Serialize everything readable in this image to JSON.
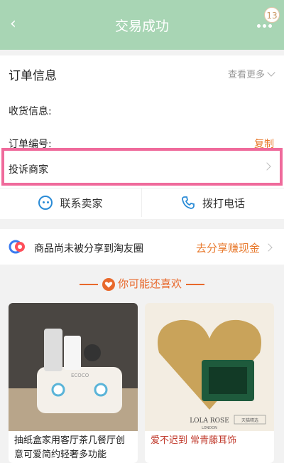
{
  "header": {
    "title": "交易成功",
    "badge": "13"
  },
  "order": {
    "section_title": "订单信息",
    "view_more": "查看更多",
    "receiver_label": "收货信息:",
    "order_no_label": "订单编号:",
    "copy_label": "复制"
  },
  "complain": {
    "label": "投诉商家"
  },
  "contact": {
    "seller_label": "联系卖家",
    "call_label": "拨打电话"
  },
  "share": {
    "text": "商品尚未被分享到淘友圈",
    "cta": "去分享赚现金"
  },
  "recommend": {
    "title": "你可能还喜欢"
  },
  "products": [
    {
      "name": "抽纸盒家用客厅茶几餐厅创意可爱简约轻奢多功能",
      "brand_text": "ECOCO"
    },
    {
      "name": "爱不迟到 常青藤耳饰",
      "brand_text": "LOLA ROSE",
      "brand_sub": "LONDON",
      "tag": "天猫精选"
    }
  ],
  "colors": {
    "header_bg": "#a8d5b4",
    "accent": "#e8792c",
    "highlight_border": "#ef6a9b",
    "link_blue": "#2a8bd6"
  }
}
